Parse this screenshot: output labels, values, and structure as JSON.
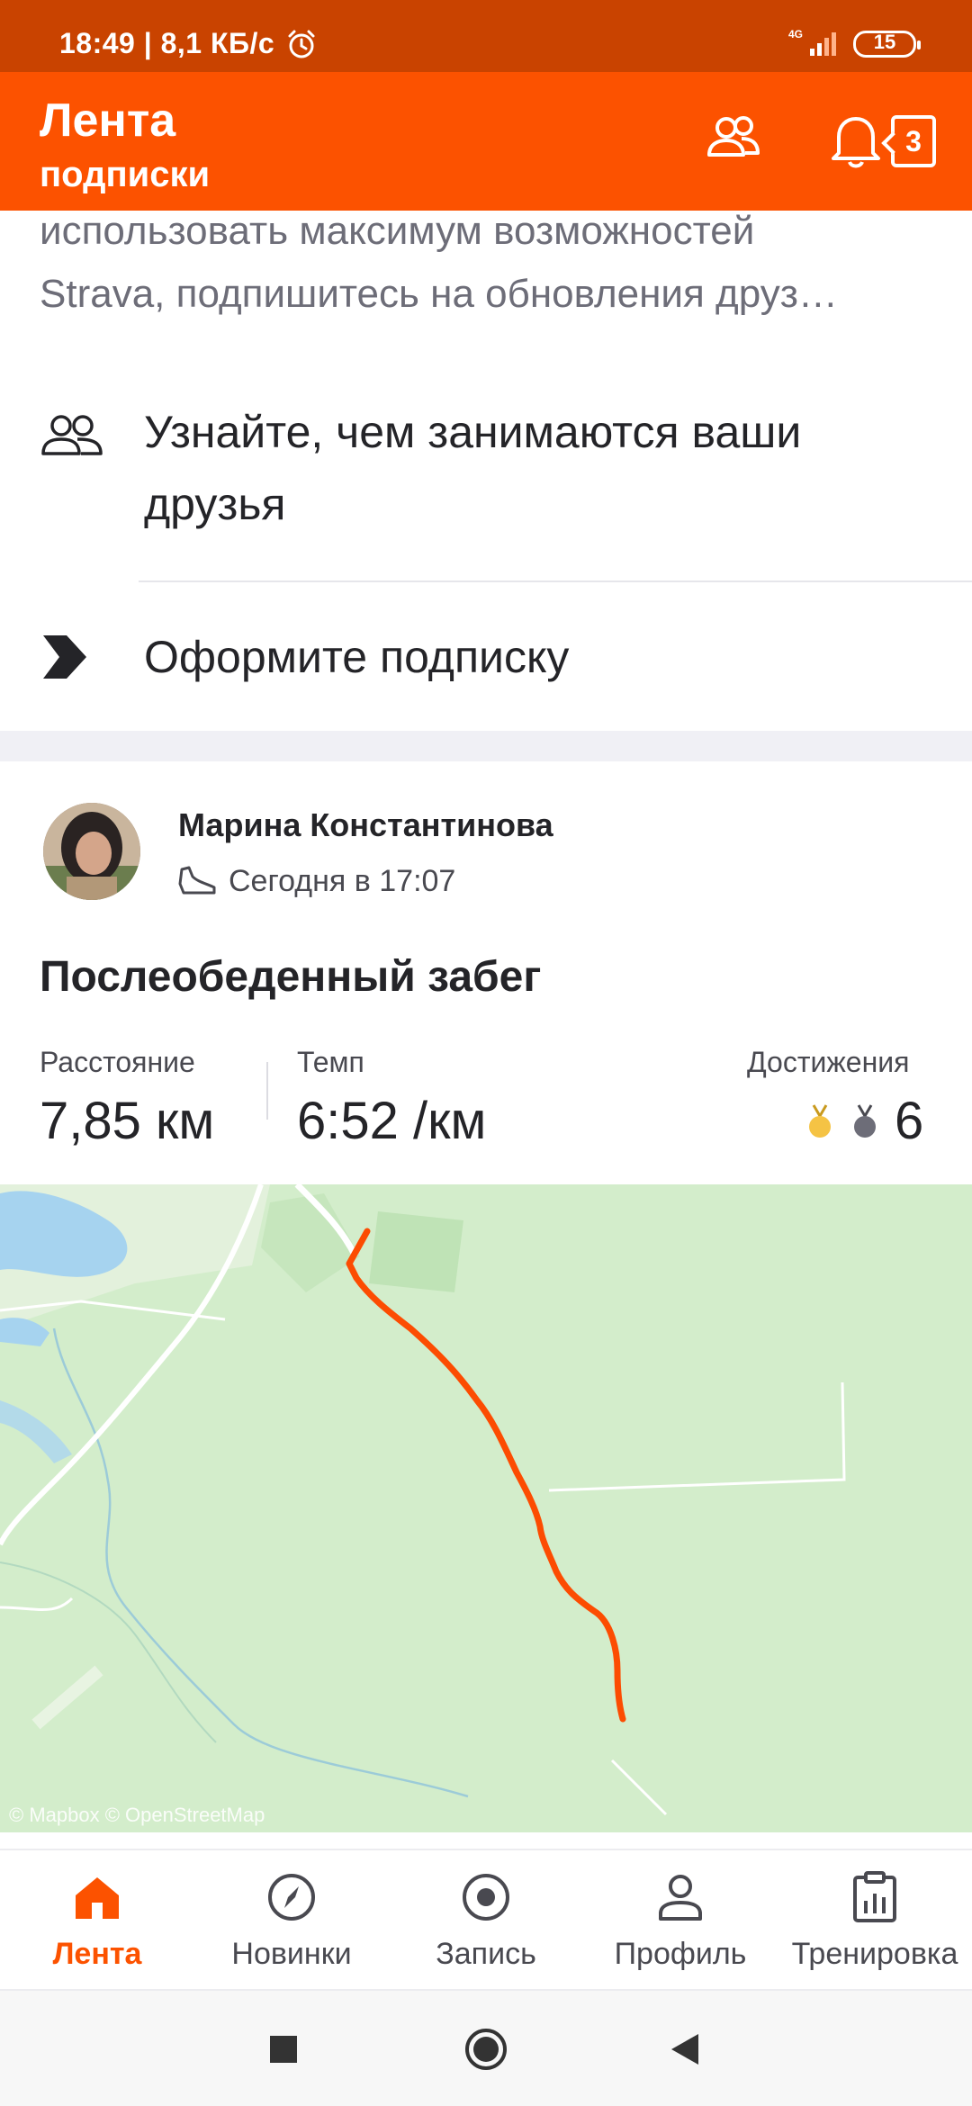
{
  "status_bar": {
    "time": "18:49",
    "speed": "8,1 КБ/с",
    "network": "4G",
    "battery": "15"
  },
  "header": {
    "title": "Лента",
    "subtitle": "подписки",
    "notification_count": "3"
  },
  "promo": {
    "line1": "использовать максимум возможностей",
    "line2": "Strava, подпишитесь на обновления друз…",
    "friends_label": "Узнайте, чем занимаются ваши друзья",
    "subscribe_label": "Оформите подписку"
  },
  "activity": {
    "athlete_name": "Марина Константинова",
    "time": "Сегодня в 17:07",
    "title": "Послеобеденный забег",
    "stats": {
      "distance_label": "Расстояние",
      "distance_value": "7,85 км",
      "pace_label": "Темп",
      "pace_value": "6:52 /км",
      "achievements_label": "Достижения",
      "achievements_value": "6"
    },
    "map_attribution": "© Mapbox © OpenStreetMap"
  },
  "tabs": [
    {
      "label": "Лента",
      "icon": "home-icon",
      "active": true
    },
    {
      "label": "Новинки",
      "icon": "compass-icon",
      "active": false
    },
    {
      "label": "Запись",
      "icon": "record-icon",
      "active": false
    },
    {
      "label": "Профиль",
      "icon": "profile-icon",
      "active": false
    },
    {
      "label": "Тренировка",
      "icon": "clipboard-chart-icon",
      "active": false
    }
  ],
  "colors": {
    "brand": "#fc5200",
    "status_bar": "#c94300",
    "route": "#fc4c02",
    "gold_medal": "#f5c344",
    "silver_medal": "#6d6d78"
  }
}
